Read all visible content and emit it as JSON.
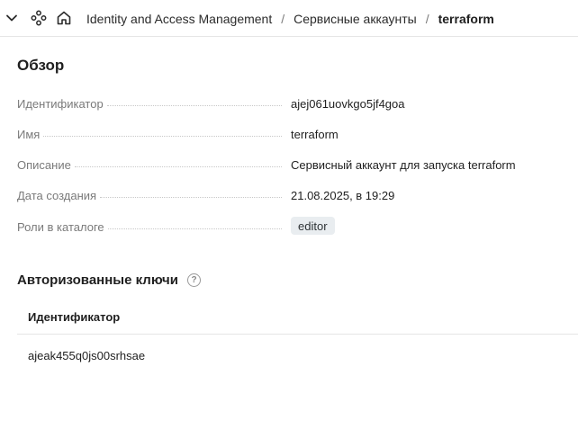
{
  "breadcrumb": {
    "items": [
      "Identity and Access Management",
      "Сервисные аккаунты"
    ],
    "separator": "/",
    "current": "terraform"
  },
  "overview": {
    "title": "Обзор",
    "props": [
      {
        "label": "Идентификатор",
        "value": "ajej061uovkgo5jf4goa"
      },
      {
        "label": "Имя",
        "value": "terraform"
      },
      {
        "label": "Описание",
        "value": "Сервисный аккаунт для запуска terraform"
      },
      {
        "label": "Дата создания",
        "value": "21.08.2025, в 19:29"
      }
    ],
    "roles": {
      "label": "Роли в каталоге",
      "badge": "editor"
    }
  },
  "keys": {
    "title": "Авторизованные ключи",
    "help_glyph": "?",
    "column": "Идентификатор",
    "rows": [
      "ajeak455q0js00srhsae"
    ]
  },
  "icons": [
    "chevron-down-icon",
    "services-icon",
    "home-icon",
    "help-icon"
  ]
}
